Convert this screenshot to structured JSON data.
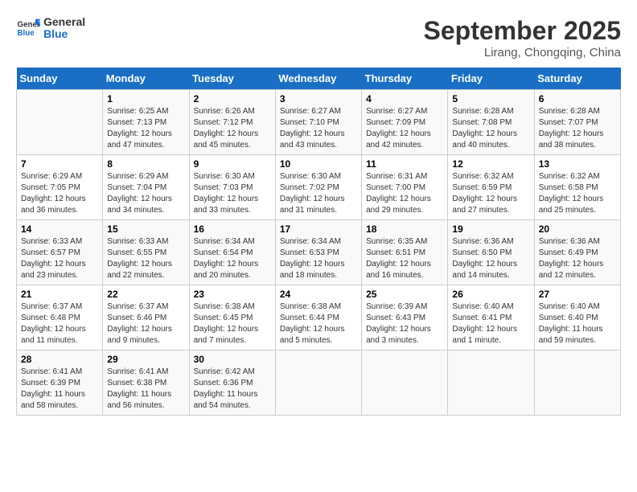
{
  "app": {
    "logo_line1": "General",
    "logo_line2": "Blue"
  },
  "header": {
    "month": "September 2025",
    "location": "Lirang, Chongqing, China"
  },
  "weekdays": [
    "Sunday",
    "Monday",
    "Tuesday",
    "Wednesday",
    "Thursday",
    "Friday",
    "Saturday"
  ],
  "weeks": [
    [
      {
        "day": "",
        "info": ""
      },
      {
        "day": "1",
        "info": "Sunrise: 6:25 AM\nSunset: 7:13 PM\nDaylight: 12 hours\nand 47 minutes."
      },
      {
        "day": "2",
        "info": "Sunrise: 6:26 AM\nSunset: 7:12 PM\nDaylight: 12 hours\nand 45 minutes."
      },
      {
        "day": "3",
        "info": "Sunrise: 6:27 AM\nSunset: 7:10 PM\nDaylight: 12 hours\nand 43 minutes."
      },
      {
        "day": "4",
        "info": "Sunrise: 6:27 AM\nSunset: 7:09 PM\nDaylight: 12 hours\nand 42 minutes."
      },
      {
        "day": "5",
        "info": "Sunrise: 6:28 AM\nSunset: 7:08 PM\nDaylight: 12 hours\nand 40 minutes."
      },
      {
        "day": "6",
        "info": "Sunrise: 6:28 AM\nSunset: 7:07 PM\nDaylight: 12 hours\nand 38 minutes."
      }
    ],
    [
      {
        "day": "7",
        "info": "Sunrise: 6:29 AM\nSunset: 7:05 PM\nDaylight: 12 hours\nand 36 minutes."
      },
      {
        "day": "8",
        "info": "Sunrise: 6:29 AM\nSunset: 7:04 PM\nDaylight: 12 hours\nand 34 minutes."
      },
      {
        "day": "9",
        "info": "Sunrise: 6:30 AM\nSunset: 7:03 PM\nDaylight: 12 hours\nand 33 minutes."
      },
      {
        "day": "10",
        "info": "Sunrise: 6:30 AM\nSunset: 7:02 PM\nDaylight: 12 hours\nand 31 minutes."
      },
      {
        "day": "11",
        "info": "Sunrise: 6:31 AM\nSunset: 7:00 PM\nDaylight: 12 hours\nand 29 minutes."
      },
      {
        "day": "12",
        "info": "Sunrise: 6:32 AM\nSunset: 6:59 PM\nDaylight: 12 hours\nand 27 minutes."
      },
      {
        "day": "13",
        "info": "Sunrise: 6:32 AM\nSunset: 6:58 PM\nDaylight: 12 hours\nand 25 minutes."
      }
    ],
    [
      {
        "day": "14",
        "info": "Sunrise: 6:33 AM\nSunset: 6:57 PM\nDaylight: 12 hours\nand 23 minutes."
      },
      {
        "day": "15",
        "info": "Sunrise: 6:33 AM\nSunset: 6:55 PM\nDaylight: 12 hours\nand 22 minutes."
      },
      {
        "day": "16",
        "info": "Sunrise: 6:34 AM\nSunset: 6:54 PM\nDaylight: 12 hours\nand 20 minutes."
      },
      {
        "day": "17",
        "info": "Sunrise: 6:34 AM\nSunset: 6:53 PM\nDaylight: 12 hours\nand 18 minutes."
      },
      {
        "day": "18",
        "info": "Sunrise: 6:35 AM\nSunset: 6:51 PM\nDaylight: 12 hours\nand 16 minutes."
      },
      {
        "day": "19",
        "info": "Sunrise: 6:36 AM\nSunset: 6:50 PM\nDaylight: 12 hours\nand 14 minutes."
      },
      {
        "day": "20",
        "info": "Sunrise: 6:36 AM\nSunset: 6:49 PM\nDaylight: 12 hours\nand 12 minutes."
      }
    ],
    [
      {
        "day": "21",
        "info": "Sunrise: 6:37 AM\nSunset: 6:48 PM\nDaylight: 12 hours\nand 11 minutes."
      },
      {
        "day": "22",
        "info": "Sunrise: 6:37 AM\nSunset: 6:46 PM\nDaylight: 12 hours\nand 9 minutes."
      },
      {
        "day": "23",
        "info": "Sunrise: 6:38 AM\nSunset: 6:45 PM\nDaylight: 12 hours\nand 7 minutes."
      },
      {
        "day": "24",
        "info": "Sunrise: 6:38 AM\nSunset: 6:44 PM\nDaylight: 12 hours\nand 5 minutes."
      },
      {
        "day": "25",
        "info": "Sunrise: 6:39 AM\nSunset: 6:43 PM\nDaylight: 12 hours\nand 3 minutes."
      },
      {
        "day": "26",
        "info": "Sunrise: 6:40 AM\nSunset: 6:41 PM\nDaylight: 12 hours\nand 1 minute."
      },
      {
        "day": "27",
        "info": "Sunrise: 6:40 AM\nSunset: 6:40 PM\nDaylight: 11 hours\nand 59 minutes."
      }
    ],
    [
      {
        "day": "28",
        "info": "Sunrise: 6:41 AM\nSunset: 6:39 PM\nDaylight: 11 hours\nand 58 minutes."
      },
      {
        "day": "29",
        "info": "Sunrise: 6:41 AM\nSunset: 6:38 PM\nDaylight: 11 hours\nand 56 minutes."
      },
      {
        "day": "30",
        "info": "Sunrise: 6:42 AM\nSunset: 6:36 PM\nDaylight: 11 hours\nand 54 minutes."
      },
      {
        "day": "",
        "info": ""
      },
      {
        "day": "",
        "info": ""
      },
      {
        "day": "",
        "info": ""
      },
      {
        "day": "",
        "info": ""
      }
    ]
  ]
}
